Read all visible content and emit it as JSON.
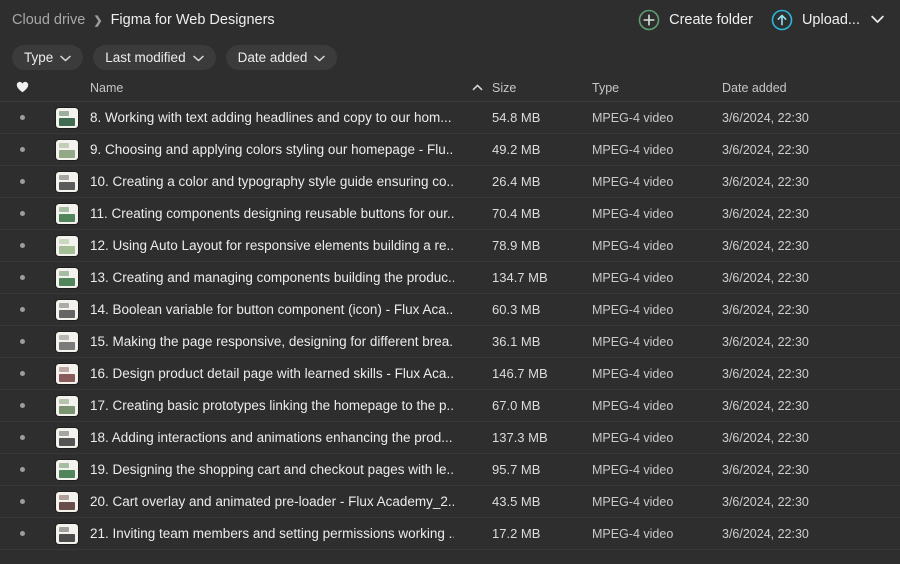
{
  "breadcrumb": {
    "root": "Cloud drive",
    "separator": "❯",
    "current": "Figma for Web Designers"
  },
  "toolbar": {
    "create_folder_label": "Create folder",
    "create_folder_icon": "plus-circle-icon",
    "create_folder_color": "#5f9e72",
    "upload_label": "Upload...",
    "upload_icon": "upload-circle-icon",
    "upload_color": "#29b8d8",
    "upload_caret": "⌄"
  },
  "filters": [
    {
      "label": "Type",
      "caret": "⌄"
    },
    {
      "label": "Last modified",
      "caret": "⌄"
    },
    {
      "label": "Date added",
      "caret": "⌄"
    }
  ],
  "columns": {
    "favorite_icon": "heart-icon",
    "name": "Name",
    "sort_indicator": "chevron-up-icon",
    "size": "Size",
    "type": "Type",
    "date_added": "Date added"
  },
  "rows": [
    {
      "marker": "•",
      "name": "8. Working with text adding headlines and copy to our hom...",
      "size": "54.8 MB",
      "type": "MPEG-4 video",
      "date": "3/6/2024, 22:30",
      "thumb": "#2f5d3f"
    },
    {
      "marker": "•",
      "name": "9. Choosing and applying colors styling our homepage - Flu...",
      "size": "49.2 MB",
      "type": "MPEG-4 video",
      "date": "3/6/2024, 22:30",
      "thumb": "#87a07a"
    },
    {
      "marker": "•",
      "name": "10. Creating a color and typography style guide ensuring co...",
      "size": "26.4 MB",
      "type": "MPEG-4 video",
      "date": "3/6/2024, 22:30",
      "thumb": "#4a4a4a"
    },
    {
      "marker": "•",
      "name": "11. Creating components designing reusable buttons for our...",
      "size": "70.4 MB",
      "type": "MPEG-4 video",
      "date": "3/6/2024, 22:30",
      "thumb": "#3f7a4d"
    },
    {
      "marker": "•",
      "name": "12. Using Auto Layout for responsive elements building a re...",
      "size": "78.9 MB",
      "type": "MPEG-4 video",
      "date": "3/6/2024, 22:30",
      "thumb": "#9bb98c"
    },
    {
      "marker": "•",
      "name": "13. Creating and managing components building the produc...",
      "size": "134.7 MB",
      "type": "MPEG-4 video",
      "date": "3/6/2024, 22:30",
      "thumb": "#3f7a4d"
    },
    {
      "marker": "•",
      "name": "14. Boolean variable for button component (icon) - Flux Aca...",
      "size": "60.3 MB",
      "type": "MPEG-4 video",
      "date": "3/6/2024, 22:30",
      "thumb": "#555555"
    },
    {
      "marker": "•",
      "name": "15. Making the page responsive, designing for different brea...",
      "size": "36.1 MB",
      "type": "MPEG-4 video",
      "date": "3/6/2024, 22:30",
      "thumb": "#6e6e6e"
    },
    {
      "marker": "•",
      "name": "16. Design product detail page with learned skills - Flux Aca...",
      "size": "146.7 MB",
      "type": "MPEG-4 video",
      "date": "3/6/2024, 22:30",
      "thumb": "#7d4a4a"
    },
    {
      "marker": "•",
      "name": "17. Creating basic prototypes linking the homepage to the p...",
      "size": "67.0 MB",
      "type": "MPEG-4 video",
      "date": "3/6/2024, 22:30",
      "thumb": "#6d8a63"
    },
    {
      "marker": "•",
      "name": "18. Adding interactions and animations enhancing the prod...",
      "size": "137.3 MB",
      "type": "MPEG-4 video",
      "date": "3/6/2024, 22:30",
      "thumb": "#444444"
    },
    {
      "marker": "•",
      "name": "19. Designing the shopping cart and checkout pages with le...",
      "size": "95.7 MB",
      "type": "MPEG-4 video",
      "date": "3/6/2024, 22:30",
      "thumb": "#3f7a4d"
    },
    {
      "marker": "•",
      "name": "20. Cart overlay and animated pre-loader - Flux Academy_2...",
      "size": "43.5 MB",
      "type": "MPEG-4 video",
      "date": "3/6/2024, 22:30",
      "thumb": "#5a3b3b"
    },
    {
      "marker": "•",
      "name": "21. Inviting team members and setting permissions working ...",
      "size": "17.2 MB",
      "type": "MPEG-4 video",
      "date": "3/6/2024, 22:30",
      "thumb": "#3a3a3a"
    }
  ]
}
